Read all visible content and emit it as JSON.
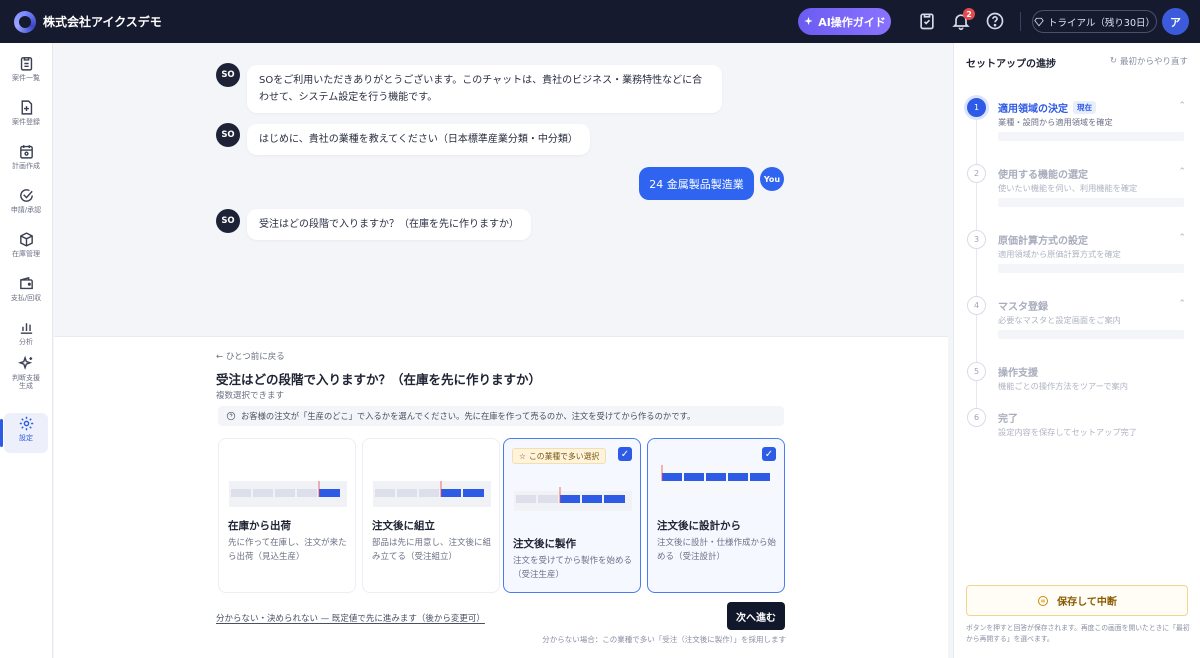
{
  "topbar": {
    "company": "株式会社アイクスデモ",
    "ai_guide_label": "AI操作ガイド",
    "notification_count": "2",
    "trial_label": "トライアル（残り30日）",
    "avatar_initial": "ア"
  },
  "sidebar": {
    "items": [
      {
        "label": "案件一覧",
        "icon": "clipboard-icon"
      },
      {
        "label": "案件登録",
        "icon": "file-plus-icon"
      },
      {
        "label": "計画作成",
        "icon": "calendar-icon"
      },
      {
        "label": "申請/承認",
        "icon": "check-circle-icon"
      },
      {
        "label": "在庫管理",
        "icon": "box-icon"
      },
      {
        "label": "支払/回収",
        "icon": "wallet-icon"
      },
      {
        "label": "分析",
        "icon": "bar-chart-icon"
      },
      {
        "label": "判断支援",
        "label2": "生成",
        "icon": "sparkle-icon"
      },
      {
        "label": "設定",
        "icon": "gear-icon",
        "active": true
      }
    ]
  },
  "chat": {
    "bot_initials": "SO",
    "user_initials": "You",
    "messages": [
      {
        "from": "bot",
        "text": "SOをご利用いただきありがとうございます。このチャットは、貴社のビジネス・業務特性などに合わせて、システム設定を行う機能です。"
      },
      {
        "from": "bot",
        "text": "はじめに、貴社の業種を教えてください（日本標準産業分類・中分類）"
      },
      {
        "from": "user",
        "text": "24 金属製品製造業"
      },
      {
        "from": "bot",
        "text": "受注はどの段階で入りますか？（在庫を先に作りますか）"
      }
    ]
  },
  "question": {
    "back_label": "ひとつ前に戻る",
    "title": "受注はどの段階で入りますか？（在庫を先に作りますか）",
    "subtitle": "複数選択できます",
    "hint": "お客様の注文が「生産のどこ」で入るかを選んでください。先に在庫を作って売るのか、注文を受けてから作るのかです。",
    "popular_tag": "この業種で多い選択",
    "options": [
      {
        "title": "在庫から出荷",
        "desc": "先に作って在庫し、注文が来たら出荷（見込生産）",
        "selected": false
      },
      {
        "title": "注文後に組立",
        "desc": "部品は先に用意し、注文後に組み立てる（受注組立）",
        "selected": false
      },
      {
        "title": "注文後に製作",
        "desc": "注文を受けてから製作を始める（受注生産）",
        "selected": true,
        "popular": true
      },
      {
        "title": "注文後に設計から",
        "desc": "注文後に設計・仕様作成から始める（受注設計）",
        "selected": true
      }
    ],
    "skip_label": "分からない・決められない — 既定値で先に進みます（後から変更可）",
    "next_label": "次へ進む",
    "footnote": "分からない場合：この業種で多い「受注（注文後に製作）」を採用します"
  },
  "setup": {
    "title": "セットアップの進捗",
    "restart_label": "最初からやり直す",
    "current_label": "現在",
    "steps": [
      {
        "num": "1",
        "title": "適用領域の決定",
        "desc": "業種・設問から適用領域を確定",
        "current": true
      },
      {
        "num": "2",
        "title": "使用する機能の選定",
        "desc": "使いたい機能を伺い、利用機能を確定"
      },
      {
        "num": "3",
        "title": "原価計算方式の設定",
        "desc": "適用領域から原価計算方式を確定"
      },
      {
        "num": "4",
        "title": "マスタ登録",
        "desc": "必要なマスタと設定画面をご案内"
      },
      {
        "num": "5",
        "title": "操作支援",
        "desc": "機能ごとの操作方法をツアーで案内"
      },
      {
        "num": "6",
        "title": "完了",
        "desc": "設定内容を保存してセットアップ完了"
      }
    ],
    "save_label": "保存して中断",
    "save_note": "ボタンを押すと回答が保存されます。再度この画面を開いたときに「最初から再開する」を選べます。"
  },
  "colors": {
    "primary": "#2e5be6",
    "topbar": "#151a2e",
    "ai_gradient_start": "#6b5cf0",
    "warning_border": "#f0d58a"
  }
}
